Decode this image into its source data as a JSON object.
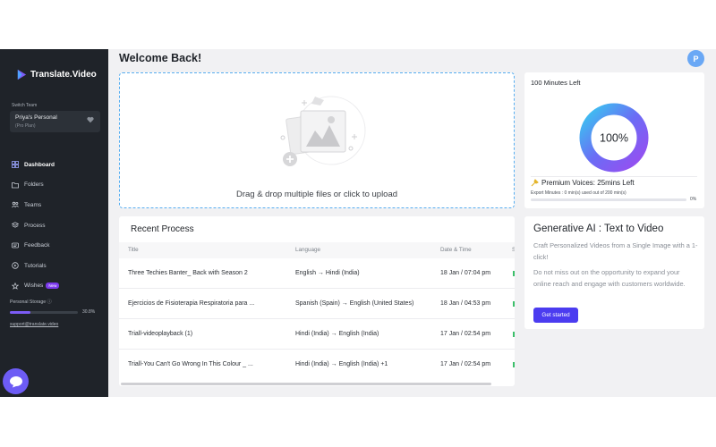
{
  "brand": {
    "name": "Translate.Video",
    "accent": "#7c5cf6"
  },
  "sidebar": {
    "switch_team_label": "Switch Team",
    "team": {
      "name": "Priya's Personal",
      "plan": "(Pro Plan)"
    },
    "items": [
      {
        "label": "Dashboard",
        "icon": "dashboard-icon",
        "active": true
      },
      {
        "label": "Folders",
        "icon": "folder-icon"
      },
      {
        "label": "Teams",
        "icon": "teams-icon"
      },
      {
        "label": "Process",
        "icon": "process-icon"
      },
      {
        "label": "Feedback",
        "icon": "feedback-icon"
      },
      {
        "label": "Tutorials",
        "icon": "tutorials-icon"
      },
      {
        "label": "Wishes",
        "icon": "wishes-icon",
        "badge": "New"
      }
    ],
    "storage": {
      "label": "Personal Storage ⓘ",
      "percent_text": "30.8%",
      "fraction": 0.308
    },
    "support_email": "support@translate.video"
  },
  "header": {
    "title": "Welcome Back!",
    "avatar_initial": "P"
  },
  "upload": {
    "text": "Drag & drop multiple files or click to upload"
  },
  "recent": {
    "title": "Recent Process",
    "columns": [
      "Title",
      "Language",
      "Date & Time",
      "S"
    ],
    "rows": [
      {
        "title": "Three Techies Banter_ Back with Season 2",
        "language": "English → Hindi (India)",
        "datetime": "18 Jan / 07:04 pm"
      },
      {
        "title": "Ejercicios de Fisioterapia Respiratoria para ...",
        "language": "Spanish (Spain) → English (United States)",
        "datetime": "18 Jan / 04:53 pm"
      },
      {
        "title": "Triall-videoplayback (1)",
        "language": "Hindi (India) → English (India)",
        "datetime": "17 Jan / 02:54 pm"
      },
      {
        "title": "Triall-You Can't Go Wrong In This Colour _ ...",
        "language": "Hindi (India) → English (India) +1",
        "datetime": "17 Jan / 02:54 pm"
      }
    ]
  },
  "minutes": {
    "title": "100 Minutes Left",
    "donut_label": "100%",
    "donut_fraction": 1.0,
    "premium": "Premium Voices: 25mins Left",
    "export_text": "Export Minutes : 0 min(s) used out of 200 min(s)",
    "export_pct": "0%",
    "export_fraction": 0.0
  },
  "genai": {
    "title": "Generative AI : Text to Video",
    "desc1": "Craft Personalized Videos from a Single Image with a 1-click!",
    "desc2": "Do not miss out on the opportunity to expand your online reach and engage with customers worldwide.",
    "cta": "Get started"
  }
}
